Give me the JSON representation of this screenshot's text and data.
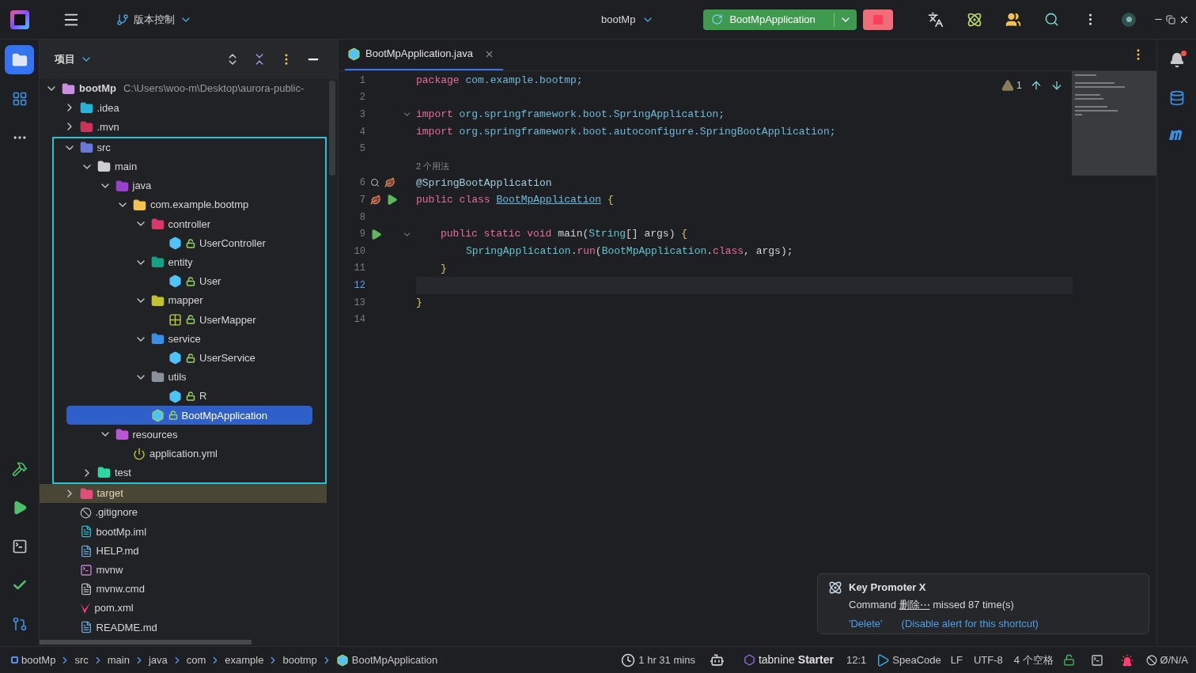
{
  "title_bar": {
    "vcs": "版本控制",
    "project": "bootMp",
    "run_config": "BootMpApplication",
    "running": true
  },
  "left_toolbar_top": [
    {
      "kind": "project",
      "selected": true
    },
    {
      "kind": "structure",
      "selected": false
    },
    {
      "kind": "more",
      "selected": false
    }
  ],
  "left_toolbar_bottom": [
    {
      "kind": "build",
      "selected": false
    },
    {
      "kind": "run",
      "selected": false
    },
    {
      "kind": "terminal",
      "selected": false
    },
    {
      "kind": "commit",
      "selected": false
    },
    {
      "kind": "git",
      "selected": false
    }
  ],
  "right_toolbar": [
    {
      "kind": "notifications"
    },
    {
      "kind": "database"
    },
    {
      "kind": "maven"
    }
  ],
  "project_panel": {
    "title": "项目",
    "tree": [
      {
        "name": "bootMp",
        "detail": "C:\\Users\\woo-m\\Desktop\\aurora-public-",
        "kind": "module",
        "expanded": true,
        "selected": false,
        "excluded": false,
        "outlined": false,
        "children": [
          {
            "name": ".idea",
            "kind": "idea",
            "expanded": false,
            "selected": false,
            "excluded": false,
            "outlined": false
          },
          {
            "name": ".mvn",
            "kind": "mvn",
            "expanded": false,
            "selected": false,
            "excluded": false,
            "outlined": false
          },
          {
            "name": "src",
            "kind": "src",
            "expanded": true,
            "selected": false,
            "excluded": false,
            "outlined": true,
            "children": [
              {
                "name": "main",
                "kind": "folder",
                "expanded": true,
                "selected": false,
                "excluded": false,
                "outlined": false,
                "children": [
                  {
                    "name": "java",
                    "kind": "java_root",
                    "expanded": true,
                    "selected": false,
                    "excluded": false,
                    "outlined": false,
                    "children": [
                      {
                        "name": "com.example.bootmp",
                        "kind": "package",
                        "expanded": true,
                        "selected": false,
                        "excluded": false,
                        "outlined": false,
                        "children": [
                          {
                            "name": "controller",
                            "kind": "controller",
                            "expanded": true,
                            "selected": false,
                            "excluded": false,
                            "outlined": false,
                            "children": [
                              {
                                "name": "UserController",
                                "kind": "class",
                                "selected": false,
                                "excluded": false,
                                "outlined": false
                              }
                            ]
                          },
                          {
                            "name": "entity",
                            "kind": "entity",
                            "expanded": true,
                            "selected": false,
                            "excluded": false,
                            "outlined": false,
                            "children": [
                              {
                                "name": "User",
                                "kind": "class",
                                "selected": false,
                                "excluded": false,
                                "outlined": false
                              }
                            ]
                          },
                          {
                            "name": "mapper",
                            "kind": "mapper",
                            "expanded": true,
                            "selected": false,
                            "excluded": false,
                            "outlined": false,
                            "children": [
                              {
                                "name": "UserMapper",
                                "kind": "interface",
                                "selected": false,
                                "excluded": false,
                                "outlined": false
                              }
                            ]
                          },
                          {
                            "name": "service",
                            "kind": "service",
                            "expanded": true,
                            "selected": false,
                            "excluded": false,
                            "outlined": false,
                            "children": [
                              {
                                "name": "UserService",
                                "kind": "class",
                                "selected": false,
                                "excluded": false,
                                "outlined": false
                              }
                            ]
                          },
                          {
                            "name": "utils",
                            "kind": "utils",
                            "expanded": true,
                            "selected": false,
                            "excluded": false,
                            "outlined": false,
                            "children": [
                              {
                                "name": "R",
                                "kind": "class",
                                "selected": false,
                                "excluded": false,
                                "outlined": false
                              }
                            ]
                          },
                          {
                            "name": "BootMpApplication",
                            "kind": "boot_class",
                            "selected": true,
                            "excluded": false,
                            "outlined": false
                          }
                        ]
                      }
                    ]
                  },
                  {
                    "name": "resources",
                    "kind": "resources",
                    "expanded": true,
                    "selected": false,
                    "excluded": false,
                    "outlined": false,
                    "children": [
                      {
                        "name": "application.yml",
                        "kind": "yaml",
                        "selected": false,
                        "excluded": false,
                        "outlined": false
                      }
                    ]
                  }
                ]
              },
              {
                "name": "test",
                "kind": "test",
                "expanded": false,
                "selected": false,
                "excluded": false,
                "outlined": false
              }
            ]
          },
          {
            "name": "target",
            "kind": "target",
            "expanded": false,
            "selected": false,
            "excluded": true,
            "outlined": false
          },
          {
            "name": ".gitignore",
            "kind": "gitignore",
            "selected": false,
            "excluded": false,
            "outlined": false
          },
          {
            "name": "bootMp.iml",
            "kind": "iml",
            "selected": false,
            "excluded": false,
            "outlined": false
          },
          {
            "name": "HELP.md",
            "kind": "markdown",
            "selected": false,
            "excluded": false,
            "outlined": false
          },
          {
            "name": "mvnw",
            "kind": "shell",
            "selected": false,
            "excluded": false,
            "outlined": false
          },
          {
            "name": "mvnw.cmd",
            "kind": "text",
            "selected": false,
            "excluded": false,
            "outlined": false
          },
          {
            "name": "pom.xml",
            "kind": "maven",
            "selected": false,
            "excluded": false,
            "outlined": false
          },
          {
            "name": "README.md",
            "kind": "markdown",
            "selected": false,
            "excluded": false,
            "outlined": false
          }
        ]
      }
    ]
  },
  "editor": {
    "tab": {
      "label": "BootMpApplication.java",
      "selected": true
    },
    "warnings": "1",
    "lines": [
      {
        "number": "1",
        "kind": "top",
        "current": false,
        "tokens": [
          {
            "t": "package ",
            "kind": "keyword"
          },
          {
            "t": "com.example.bootmp;",
            "kind": "ident"
          }
        ]
      },
      {
        "number": "2",
        "kind": "top",
        "current": false
      },
      {
        "number": "3",
        "kind": "top",
        "current": false,
        "fold": true,
        "tokens": [
          {
            "t": "import ",
            "kind": "keyword"
          },
          {
            "t": "org.springframework.boot.SpringApplication;",
            "kind": "ident"
          }
        ]
      },
      {
        "number": "4",
        "kind": "top",
        "current": false,
        "tokens": [
          {
            "t": "import ",
            "kind": "keyword"
          },
          {
            "t": "org.springframework.boot.autoconfigure.SpringBootApplication;",
            "kind": "ident"
          }
        ]
      },
      {
        "number": "5",
        "kind": "top",
        "current": false
      },
      {
        "number": "6",
        "kind": "top",
        "current": false,
        "hint": "2 个用法",
        "gutter": [
          {
            "kind": "find"
          },
          {
            "kind": "bean"
          }
        ],
        "tokens": [
          {
            "t": "@SpringBootApplication",
            "kind": "annotation"
          }
        ]
      },
      {
        "number": "7",
        "kind": "top",
        "current": false,
        "gutter": [
          {
            "kind": "bean"
          },
          {
            "kind": "run"
          }
        ],
        "tokens": [
          {
            "t": "public class ",
            "kind": "keyword"
          },
          {
            "t": "BootMpApplication",
            "kind": "declaration"
          },
          {
            "t": "{",
            "kind": "brace"
          }
        ]
      },
      {
        "number": "8",
        "kind": "top",
        "current": false
      },
      {
        "number": "9",
        "kind": "member",
        "current": false,
        "fold": true,
        "gutter": [
          {
            "kind": "run"
          }
        ],
        "tokens": [
          {
            "t": "public static void ",
            "kind": "keyword"
          },
          {
            "t": "main(",
            "kind": "plain"
          },
          {
            "t": "String",
            "kind": "type"
          },
          {
            "t": "[] args) ",
            "kind": "plain"
          },
          {
            "t": "{",
            "kind": "brace"
          }
        ]
      },
      {
        "number": "10",
        "kind": "statement",
        "current": false,
        "tokens": [
          {
            "t": "SpringApplication",
            "kind": "type"
          },
          {
            "t": ".",
            "kind": "plain"
          },
          {
            "t": "run",
            "kind": "method"
          },
          {
            "t": "(",
            "kind": "plain"
          },
          {
            "t": "BootMpApplication",
            "kind": "type"
          },
          {
            "t": ".",
            "kind": "plain"
          },
          {
            "t": "class",
            "kind": "keyword"
          },
          {
            "t": ", args);",
            "kind": "plain"
          }
        ]
      },
      {
        "number": "11",
        "kind": "member",
        "current": false,
        "tokens": [
          {
            "t": "}",
            "kind": "brace"
          }
        ]
      },
      {
        "number": "12",
        "kind": "top",
        "current": true
      },
      {
        "number": "13",
        "kind": "top",
        "current": false,
        "tokens": [
          {
            "t": "}",
            "kind": "brace"
          }
        ]
      },
      {
        "number": "14",
        "kind": "top",
        "current": false
      }
    ]
  },
  "notification": {
    "title": "Key Promoter X",
    "message_start": "Command",
    "command": "删除⋯",
    "message_end": "missed 87 time(s)",
    "actions": [
      "'Delete'",
      "(Disable alert for this shortcut)"
    ]
  },
  "status_bar": {
    "breadcrumbs": [
      {
        "label": "bootMp",
        "kind": "module"
      },
      {
        "label": "src",
        "kind": "plain"
      },
      {
        "label": "main",
        "kind": "plain"
      },
      {
        "label": "java",
        "kind": "plain"
      },
      {
        "label": "com",
        "kind": "plain"
      },
      {
        "label": "example",
        "kind": "plain"
      },
      {
        "label": "bootmp",
        "kind": "plain"
      },
      {
        "label": "BootMpApplication",
        "kind": "boot_class"
      }
    ],
    "time_tracker": "1 hr 31 mins",
    "tabnine": "tabnine",
    "tabnine_plan": "Starter",
    "position": "12:1",
    "speacode": "SpeaCode",
    "line_ending": "LF",
    "encoding": "UTF-8",
    "indent": "4 个空格",
    "na": "Ø/N/A"
  }
}
